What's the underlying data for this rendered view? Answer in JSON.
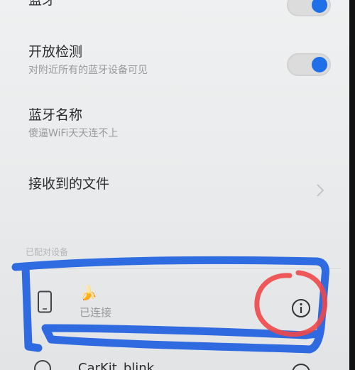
{
  "settings": {
    "top_item": {
      "title": "蓝牙",
      "toggle_on": true
    },
    "open_detection": {
      "title": "开放检测",
      "subtitle": "对附近所有的蓝牙设备可见",
      "toggle_on": true
    },
    "bluetooth_name": {
      "title": "蓝牙名称",
      "subtitle": "傻逼WiFi天天连不上"
    },
    "received_files": {
      "title": "接收到的文件",
      "chevron_icon": "chevron-right-icon"
    }
  },
  "paired_devices": {
    "section_label": "已配对设备",
    "devices": [
      {
        "name": "🍌",
        "status": "已连接",
        "icon": "phone-icon",
        "info_icon": "info-icon"
      },
      {
        "name": "CarKit_blink",
        "icon": "device-icon",
        "info_icon": "info-icon"
      }
    ]
  },
  "colors": {
    "accent": "#1e6fe8",
    "annotation_blue": "#1f5fe0",
    "annotation_red": "#f04848"
  }
}
